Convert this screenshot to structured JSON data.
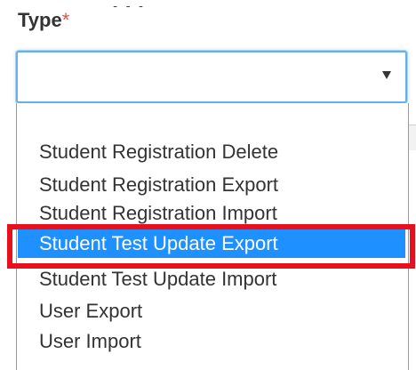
{
  "field": {
    "label": "Type",
    "required_marker": "*",
    "selected_value": ""
  },
  "dropdown": {
    "options": [
      {
        "label": "Student Registration Delete",
        "selected": false
      },
      {
        "label": "Student Registration Export",
        "selected": false
      },
      {
        "label": "Student Registration Import",
        "selected": false
      },
      {
        "label": "Student Test Update Export",
        "selected": true
      },
      {
        "label": "Student Test Update Import",
        "selected": false
      },
      {
        "label": "User Export",
        "selected": false
      },
      {
        "label": "User Import",
        "selected": false
      }
    ],
    "caret_icon": "chevron-down-icon"
  },
  "colors": {
    "selection": "#1e90ff",
    "highlight_frame": "#e8101c",
    "focus_border": "#66afe9",
    "required": "#d9534f"
  }
}
